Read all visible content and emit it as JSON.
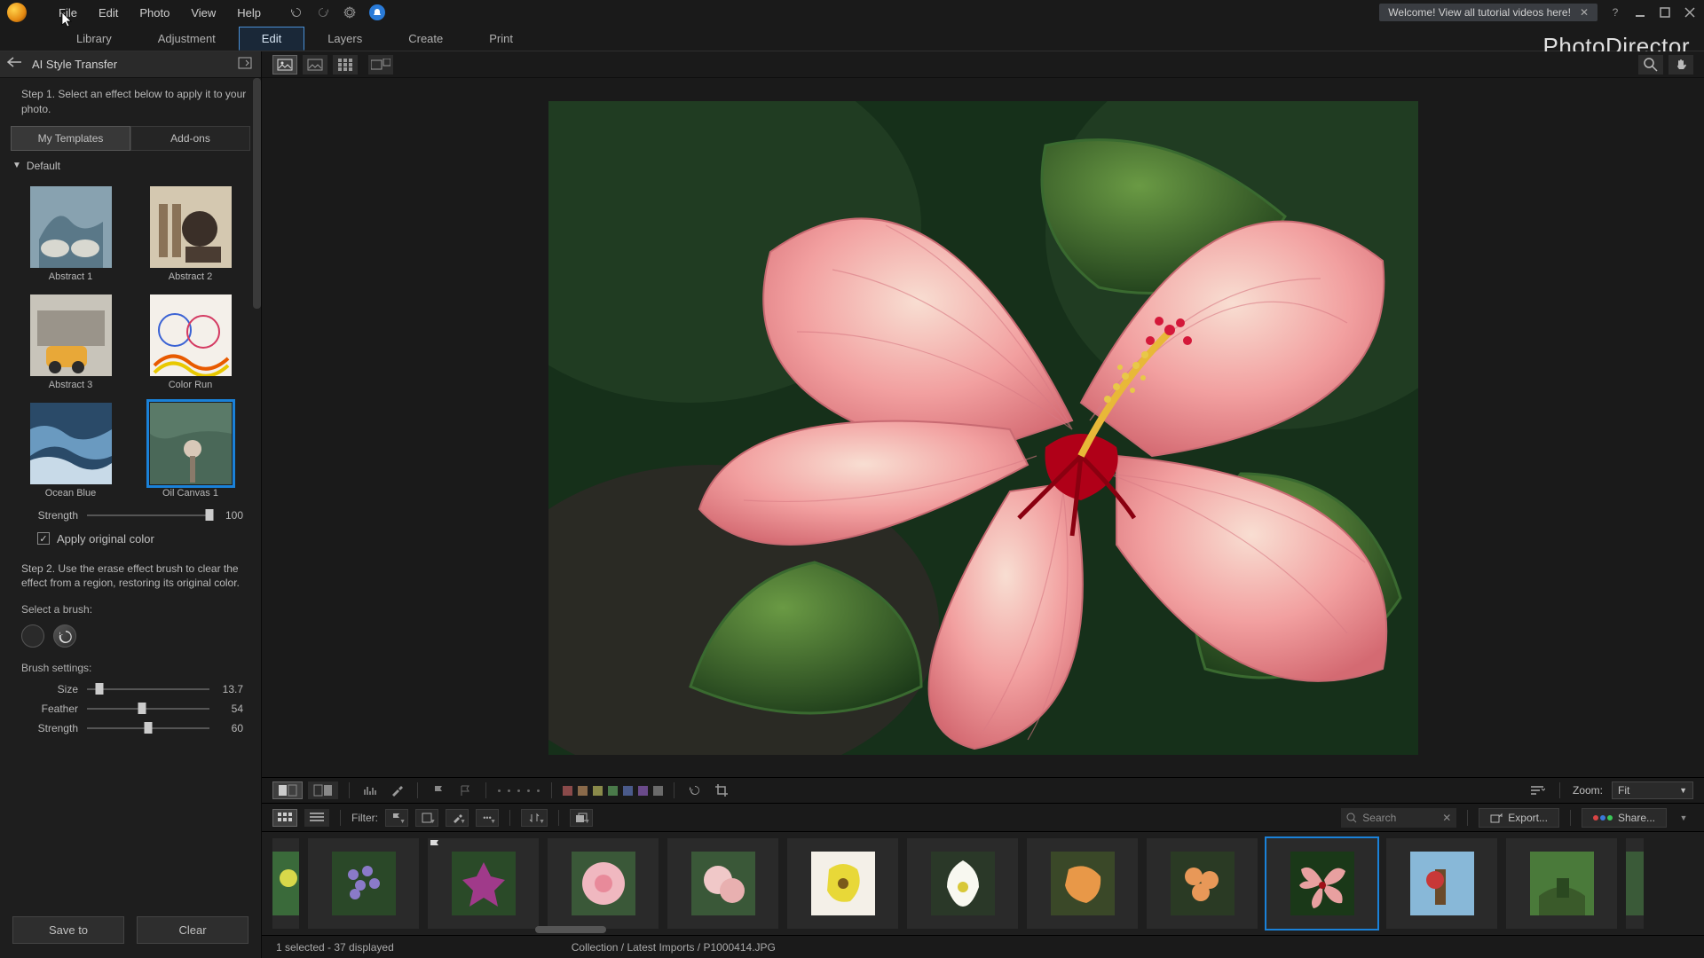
{
  "menu": {
    "items": [
      "File",
      "Edit",
      "Photo",
      "View",
      "Help"
    ]
  },
  "welcome_banner": "Welcome! View all tutorial videos here!",
  "brand": "PhotoDirector",
  "main_tabs": [
    "Library",
    "Adjustment",
    "Edit",
    "Layers",
    "Create",
    "Print"
  ],
  "main_tab_active": 2,
  "sidebar": {
    "title": "AI Style Transfer",
    "step1_text": "Step 1. Select an effect below to apply it to your photo.",
    "sub_tabs": [
      "My Templates",
      "Add-ons"
    ],
    "sub_tab_active": 0,
    "accordion_label": "Default",
    "templates": [
      "Abstract 1",
      "Abstract 2",
      "Abstract 3",
      "Color Run",
      "Ocean Blue",
      "Oil Canvas 1"
    ],
    "template_selected": 5,
    "strength_label": "Strength",
    "strength_value": "100",
    "apply_original_label": "Apply original color",
    "apply_original_checked": true,
    "step2_text": "Step 2. Use the erase effect brush to clear the effect from a region, restoring its original color.",
    "select_brush_label": "Select a brush:",
    "brush_settings_label": "Brush settings:",
    "size_label": "Size",
    "size_value": "13.7",
    "feather_label": "Feather",
    "feather_value": "54",
    "bstrength_label": "Strength",
    "bstrength_value": "60",
    "save_btn": "Save to",
    "clear_btn": "Clear"
  },
  "lower": {
    "zoom_label": "Zoom:",
    "zoom_value": "Fit",
    "label_colors": [
      "#c94444",
      "#c98f44",
      "#c9c944",
      "#52a552",
      "#4488c9",
      "#8b5cc9",
      "#888888"
    ]
  },
  "filterbar": {
    "filter_label": "Filter:",
    "search_placeholder": "Search",
    "export_label": "Export...",
    "share_label": "Share..."
  },
  "status": {
    "selection": "1 selected - 37 displayed",
    "path": "Collection / Latest Imports / P1000414.JPG"
  }
}
